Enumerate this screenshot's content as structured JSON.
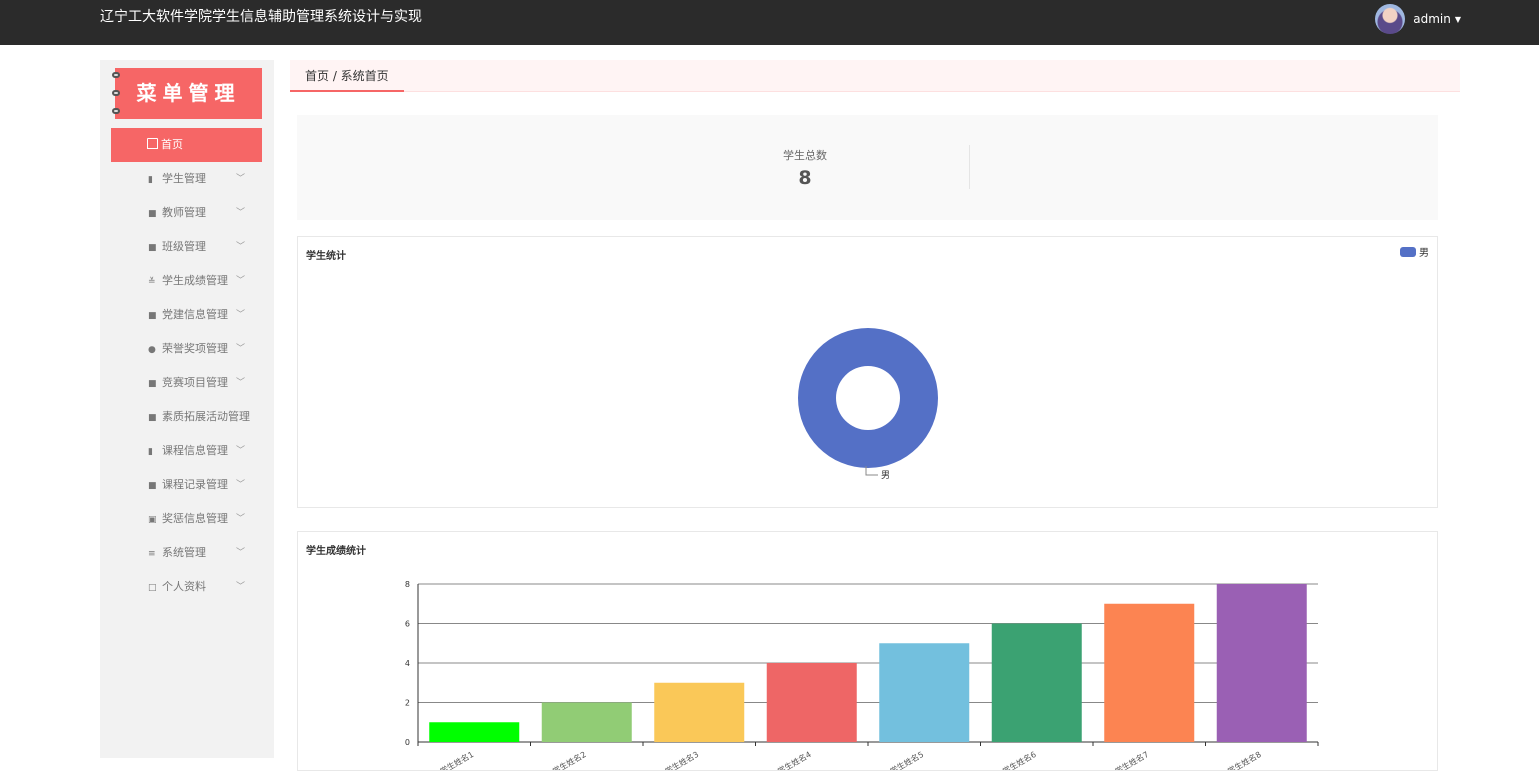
{
  "app": {
    "title": "辽宁工大软件学院学生信息辅助管理系统设计与实现",
    "username": "admin"
  },
  "sidebar": {
    "banner": "菜单管理",
    "home_label": "首页",
    "items": [
      {
        "label": "学生管理",
        "icon": "book-icon",
        "expandable": true
      },
      {
        "label": "教师管理",
        "icon": "grid-icon",
        "expandable": true
      },
      {
        "label": "班级管理",
        "icon": "grid-icon",
        "expandable": true
      },
      {
        "label": "学生成绩管理",
        "icon": "sliders-icon",
        "expandable": true
      },
      {
        "label": "党建信息管理",
        "icon": "grid-icon",
        "expandable": true
      },
      {
        "label": "荣誉奖项管理",
        "icon": "pin-icon",
        "expandable": true
      },
      {
        "label": "竞赛项目管理",
        "icon": "grid-icon",
        "expandable": true
      },
      {
        "label": "素质拓展活动管理",
        "icon": "grid-icon",
        "expandable": false
      },
      {
        "label": "课程信息管理",
        "icon": "bar-chart-icon",
        "expandable": true
      },
      {
        "label": "课程记录管理",
        "icon": "grid-icon",
        "expandable": true
      },
      {
        "label": "奖惩信息管理",
        "icon": "clipboard-icon",
        "expandable": true
      },
      {
        "label": "系统管理",
        "icon": "menu-icon",
        "expandable": true
      },
      {
        "label": "个人资料",
        "icon": "card-icon",
        "expandable": true
      }
    ]
  },
  "breadcrumb": "首页 / 系统首页",
  "stats": {
    "label": "学生总数",
    "value": "8"
  },
  "colors": {
    "accent": "#f66666",
    "topbar": "#2b2b2b"
  },
  "chart_data": [
    {
      "type": "pie",
      "title": "学生统计",
      "legend": [
        "男"
      ],
      "legend_position": "top-right",
      "slices": [
        {
          "label": "男",
          "value": 8,
          "color": "#5470c6"
        }
      ]
    },
    {
      "type": "bar",
      "title": "学生成绩统计",
      "categories": [
        "学生姓名1",
        "学生姓名2",
        "学生姓名3",
        "学生姓名4",
        "学生姓名5",
        "学生姓名6",
        "学生姓名7",
        "学生姓名8"
      ],
      "values": [
        1,
        2,
        3,
        4,
        5,
        6,
        7,
        8
      ],
      "colors": [
        "#00ff00",
        "#91cc75",
        "#fac858",
        "#ee6666",
        "#73c0de",
        "#3ba272",
        "#fc8452",
        "#9a60b4"
      ],
      "yticks": [
        0,
        2,
        4,
        6,
        8
      ],
      "ylim": [
        0,
        8
      ],
      "grid": true
    }
  ]
}
